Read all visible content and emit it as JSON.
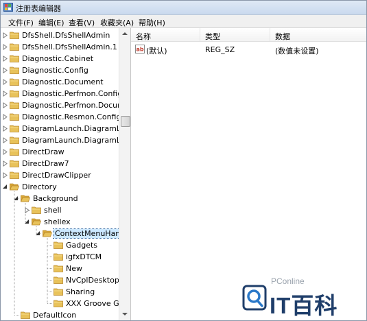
{
  "window": {
    "title": "注册表编辑器",
    "icon": "regedit-icon"
  },
  "menu": [
    "文件(F)",
    "编辑(E)",
    "查看(V)",
    "收藏夹(A)",
    "帮助(H)"
  ],
  "tree": [
    {
      "label": "DfsShell.DfsShellAdmin",
      "level": 0,
      "expand": "collapsed"
    },
    {
      "label": "DfsShell.DfsShellAdmin.1",
      "level": 0,
      "expand": "collapsed"
    },
    {
      "label": "Diagnostic.Cabinet",
      "level": 0,
      "expand": "collapsed"
    },
    {
      "label": "Diagnostic.Config",
      "level": 0,
      "expand": "collapsed"
    },
    {
      "label": "Diagnostic.Document",
      "level": 0,
      "expand": "collapsed"
    },
    {
      "label": "Diagnostic.Perfmon.Config",
      "level": 0,
      "expand": "collapsed"
    },
    {
      "label": "Diagnostic.Perfmon.Docume",
      "level": 0,
      "expand": "collapsed"
    },
    {
      "label": "Diagnostic.Resmon.Config",
      "level": 0,
      "expand": "collapsed"
    },
    {
      "label": "DiagramLaunch.DiagramLau",
      "level": 0,
      "expand": "collapsed"
    },
    {
      "label": "DiagramLaunch.DiagramLau",
      "level": 0,
      "expand": "collapsed"
    },
    {
      "label": "DirectDraw",
      "level": 0,
      "expand": "collapsed"
    },
    {
      "label": "DirectDraw7",
      "level": 0,
      "expand": "collapsed"
    },
    {
      "label": "DirectDrawClipper",
      "level": 0,
      "expand": "collapsed"
    },
    {
      "label": "Directory",
      "level": 0,
      "expand": "expanded"
    },
    {
      "label": "Background",
      "level": 1,
      "expand": "expanded"
    },
    {
      "label": "shell",
      "level": 2,
      "expand": "collapsed"
    },
    {
      "label": "shellex",
      "level": 2,
      "expand": "expanded"
    },
    {
      "label": "ContextMenuHand",
      "level": 3,
      "expand": "expanded",
      "selected": true
    },
    {
      "label": "Gadgets",
      "level": 4,
      "expand": "none"
    },
    {
      "label": "igfxDTCM",
      "level": 4,
      "expand": "none"
    },
    {
      "label": "New",
      "level": 4,
      "expand": "none"
    },
    {
      "label": "NvCplDesktopC",
      "level": 4,
      "expand": "none"
    },
    {
      "label": "Sharing",
      "level": 4,
      "expand": "none"
    },
    {
      "label": "XXX Groove GI",
      "level": 4,
      "expand": "none"
    },
    {
      "label": "DefaultIcon",
      "level": 1,
      "expand": "none"
    }
  ],
  "values": {
    "columns": [
      "名称",
      "类型",
      "数据"
    ],
    "rows": [
      {
        "name": "(默认)",
        "type": "REG_SZ",
        "data": "(数值未设置)",
        "icon": "string-value-icon"
      }
    ]
  },
  "watermark": {
    "small": "PConline",
    "big": "IT百科"
  },
  "colors": {
    "folder": "#e8c25a",
    "selection": "#cce8ff",
    "brand": "#1f3e6a"
  }
}
